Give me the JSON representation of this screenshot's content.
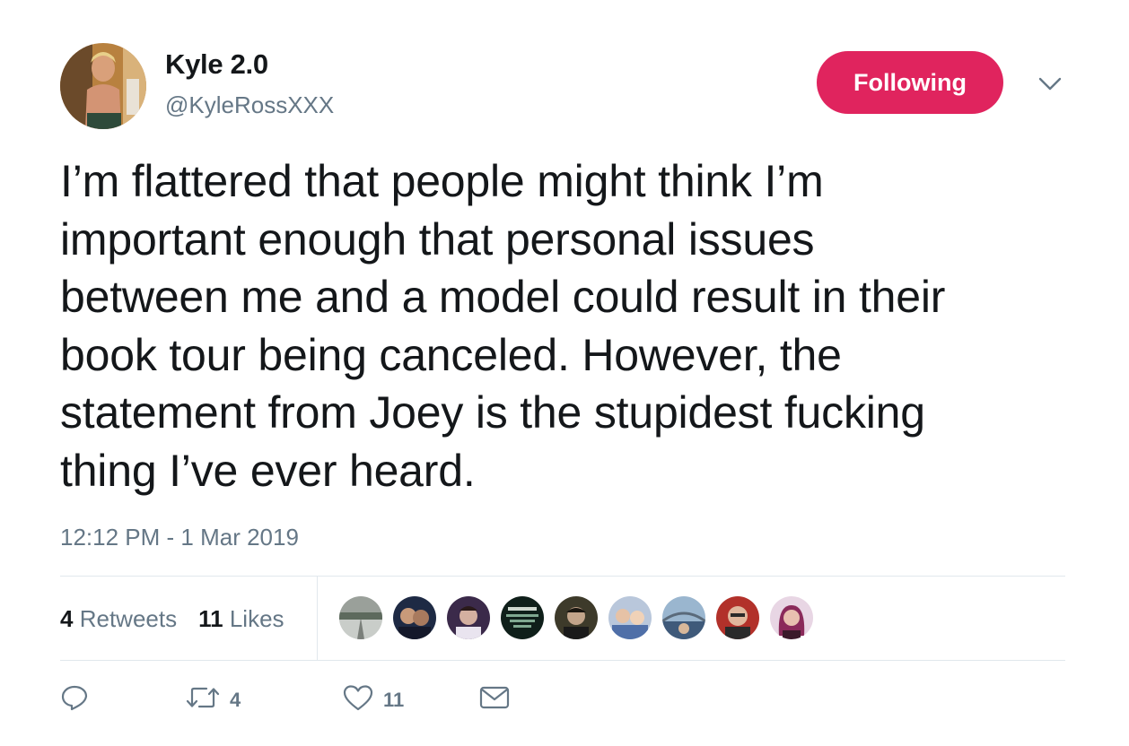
{
  "author": {
    "display_name": "Kyle 2.0",
    "handle": "@KyleRossXXX"
  },
  "follow_button": {
    "label": "Following",
    "color": "#e0245e"
  },
  "tweet": {
    "text": "I’m flattered that people might think I’m\nimportant enough that personal issues\nbetween me and a model could result in their\nbook tour being canceled. However, the\nstatement from Joey is the stupidest fucking\nthing I’ve ever heard.",
    "timestamp": "12:12 PM - 1 Mar 2019"
  },
  "stats": {
    "retweets_count": "4",
    "retweets_label": "Retweets",
    "likes_count": "11",
    "likes_label": "Likes"
  },
  "liker_avatars": [
    {
      "icon": "liker-avatar-road",
      "color": "#8a8f8a"
    },
    {
      "icon": "liker-avatar-couple",
      "color": "#1e2a44"
    },
    {
      "icon": "liker-avatar-man-purple",
      "color": "#3b2a4a"
    },
    {
      "icon": "liker-avatar-did-you-know",
      "color": "#1a3a2e"
    },
    {
      "icon": "liker-avatar-man-dark",
      "color": "#2b2b22"
    },
    {
      "icon": "liker-avatar-group",
      "color": "#a7b8cf"
    },
    {
      "icon": "liker-avatar-bridge",
      "color": "#5f7f9a"
    },
    {
      "icon": "liker-avatar-man-red",
      "color": "#b2312a"
    },
    {
      "icon": "liker-avatar-woman-pink",
      "color": "#c45b8a"
    }
  ],
  "actions": {
    "reply_icon": "reply-icon",
    "retweet_icon": "retweet-icon",
    "retweet_count": "4",
    "like_icon": "heart-icon",
    "like_count": "11",
    "dm_icon": "envelope-icon"
  },
  "colors": {
    "text": "#14171a",
    "secondary": "#657786",
    "divider": "#e1e8ed"
  }
}
